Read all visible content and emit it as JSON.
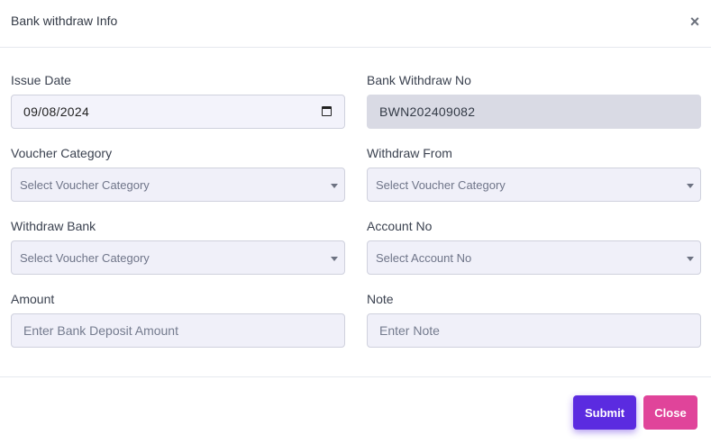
{
  "modal": {
    "title": "Bank withdraw Info",
    "close_icon": "close-icon"
  },
  "fields": {
    "issue_date": {
      "label": "Issue Date",
      "value": "09/08/2024"
    },
    "withdraw_no": {
      "label": "Bank Withdraw No",
      "value": "BWN202409082"
    },
    "voucher_category": {
      "label": "Voucher Category",
      "value": "Select Voucher Category"
    },
    "withdraw_from": {
      "label": "Withdraw From",
      "value": "Select Voucher Category"
    },
    "withdraw_bank": {
      "label": "Withdraw Bank",
      "value": "Select Voucher Category"
    },
    "account_no": {
      "label": "Account No",
      "value": "Select Account No"
    },
    "amount": {
      "label": "Amount",
      "placeholder": "Enter Bank Deposit Amount"
    },
    "note": {
      "label": "Note",
      "placeholder": "Enter Note"
    }
  },
  "footer": {
    "submit_label": "Submit",
    "close_label": "Close"
  },
  "colors": {
    "submit": "#5b2be0",
    "close": "#e0449a",
    "field_bg": "#f0f0f9",
    "readonly_bg": "#d9dae4"
  }
}
